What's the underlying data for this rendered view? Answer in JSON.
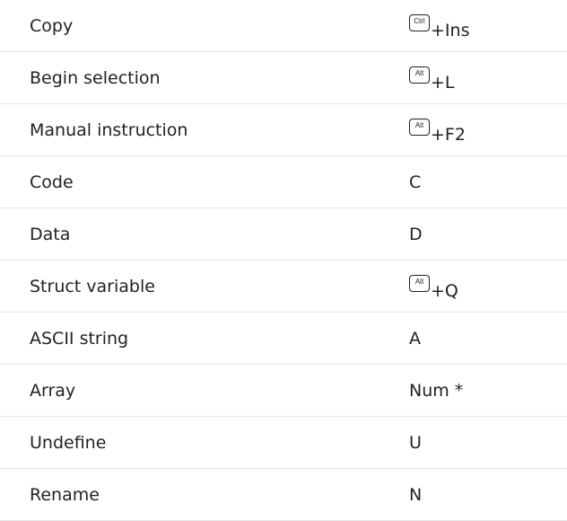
{
  "shortcuts": [
    {
      "action": "Copy",
      "modifier": "Ctrl",
      "key": "+Ins"
    },
    {
      "action": "Begin selection",
      "modifier": "Alt",
      "key": "+L"
    },
    {
      "action": "Manual instruction",
      "modifier": "Alt",
      "key": "+F2"
    },
    {
      "action": "Code",
      "modifier": "",
      "key": "C"
    },
    {
      "action": "Data",
      "modifier": "",
      "key": "D"
    },
    {
      "action": "Struct variable",
      "modifier": "Alt",
      "key": "+Q"
    },
    {
      "action": "ASCII string",
      "modifier": "",
      "key": "A"
    },
    {
      "action": "Array",
      "modifier": "",
      "key": "Num *"
    },
    {
      "action": "Undefine",
      "modifier": "",
      "key": "U"
    },
    {
      "action": "Rename",
      "modifier": "",
      "key": "N"
    }
  ]
}
